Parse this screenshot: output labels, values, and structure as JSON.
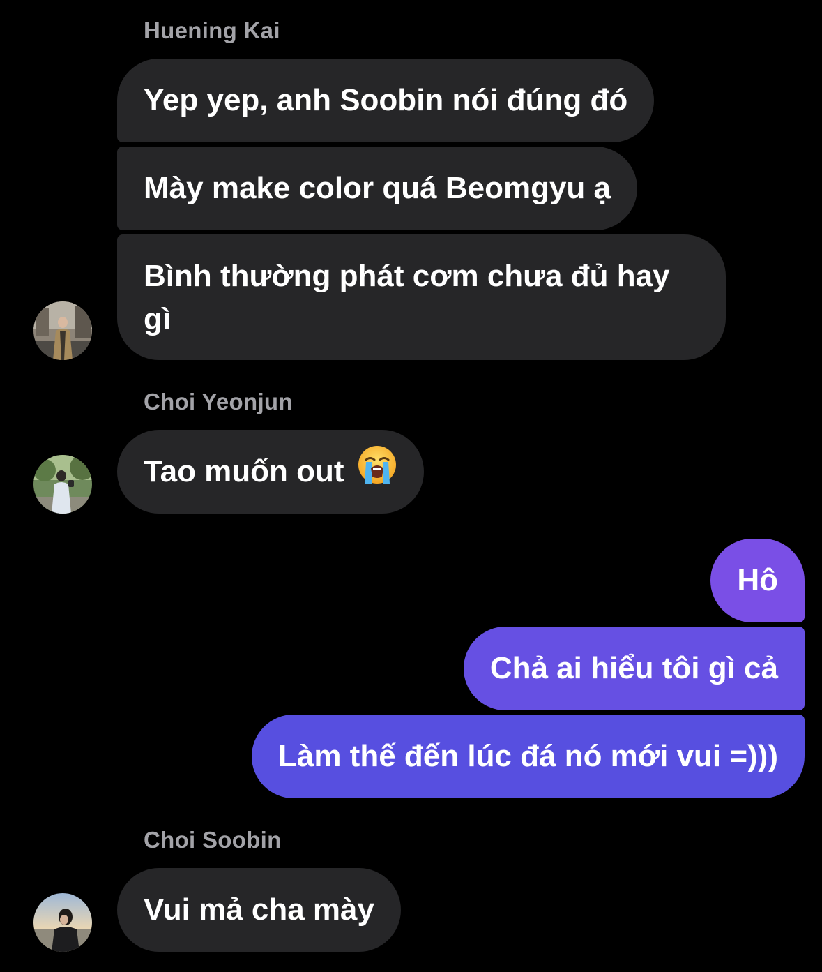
{
  "messages": [
    {
      "group": "huening",
      "sender": "Huening Kai",
      "bubbles": [
        "Yep yep, anh Soobin nói đúng đó",
        "Mày make color quá Beomgyu ạ",
        "Bình thường phát cơm chưa đủ hay gì"
      ]
    },
    {
      "group": "yeonjun",
      "sender": "Choi Yeonjun",
      "bubbles": [
        "Tao muốn out"
      ],
      "emoji": "loudly-crying-face-emoji"
    },
    {
      "group": "me",
      "bubbles": [
        "Hô",
        "Chả ai hiểu tôi gì cả",
        "Làm thế đến lúc đá nó mới vui =)))"
      ]
    },
    {
      "group": "soobin",
      "sender": "Choi Soobin",
      "bubbles": [
        "Vui mả cha mày"
      ]
    }
  ],
  "colors": {
    "background": "#000000",
    "incoming_bubble": "#262628",
    "outgoing_bubble_top": "#7a4fe6",
    "outgoing_bubble_bottom": "#564fe0",
    "sender_name": "#a3a3a8",
    "text": "#ffffff"
  }
}
